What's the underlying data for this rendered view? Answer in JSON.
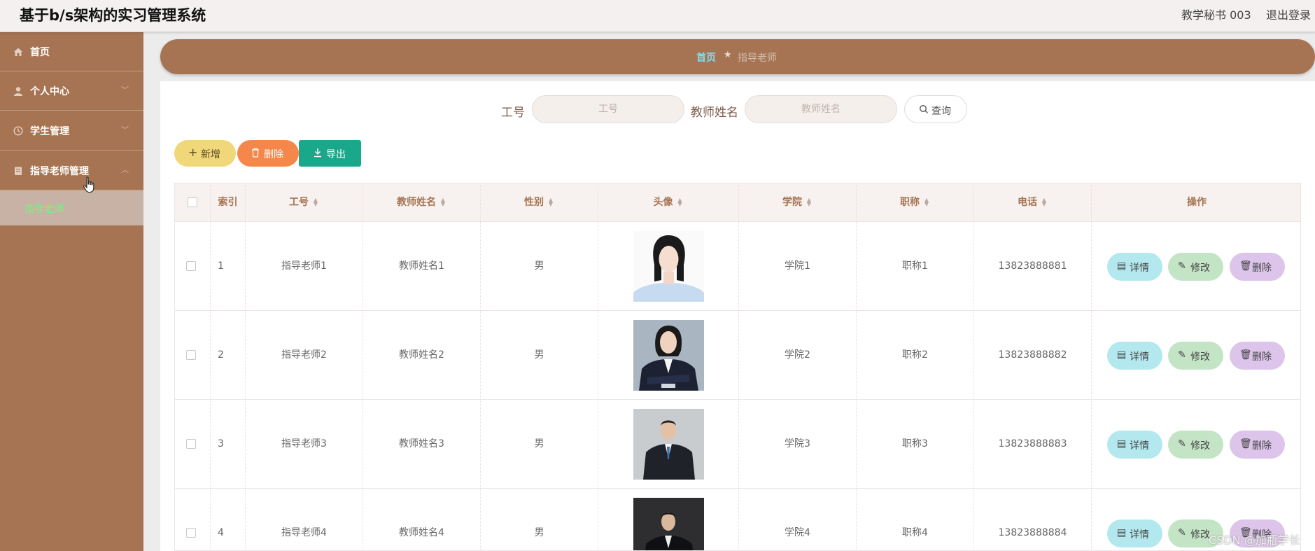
{
  "header": {
    "app_title": "基于b/s架构的实习管理系统",
    "user": "教学秘书 003",
    "logout": "退出登录"
  },
  "sidebar": {
    "items": [
      {
        "label": "首页",
        "icon": "home-icon"
      },
      {
        "label": "个人中心",
        "icon": "user-icon"
      },
      {
        "label": "学生管理",
        "icon": "clock-icon"
      },
      {
        "label": "指导老师管理",
        "icon": "document-icon"
      }
    ],
    "active_sub": {
      "label": "指导老师"
    }
  },
  "breadcrumb": {
    "home": "首页",
    "separator": "★",
    "current": "指导老师"
  },
  "search": {
    "field1_label": "工号",
    "field1_placeholder": "工号",
    "field2_label": "教师姓名",
    "field2_placeholder": "教师姓名",
    "query_label": "查询"
  },
  "toolbar": {
    "add_label": "新增",
    "delete_label": "删除",
    "export_label": "导出"
  },
  "table": {
    "headers": [
      "索引",
      "工号",
      "教师姓名",
      "性别",
      "头像",
      "学院",
      "职称",
      "电话",
      "操作"
    ],
    "rows": [
      {
        "index": "1",
        "job_no": "指导老师1",
        "name": "教师姓名1",
        "gender": "男",
        "college": "学院1",
        "title": "职称1",
        "phone": "13823888881"
      },
      {
        "index": "2",
        "job_no": "指导老师2",
        "name": "教师姓名2",
        "gender": "男",
        "college": "学院2",
        "title": "职称2",
        "phone": "13823888882"
      },
      {
        "index": "3",
        "job_no": "指导老师3",
        "name": "教师姓名3",
        "gender": "男",
        "college": "学院3",
        "title": "职称3",
        "phone": "13823888883"
      },
      {
        "index": "4",
        "job_no": "指导老师4",
        "name": "教师姓名4",
        "gender": "男",
        "college": "学院4",
        "title": "职称4",
        "phone": "13823888884"
      }
    ],
    "actions": {
      "detail": "详情",
      "edit": "修改",
      "delete": "删除"
    }
  },
  "watermark": "CSDN @加瓶学长",
  "colors": {
    "brand_brown": "#a67452",
    "breadcrumb_home": "#7ce0ee",
    "active_submenu_text": "#7cf07c",
    "add_button": "#f0d77a",
    "delete_button": "#f6874a",
    "export_button": "#1aa88a",
    "detail_button": "#b4e8ef",
    "edit_button": "#c4e4c6",
    "row_delete_button": "#dcc4ea"
  }
}
